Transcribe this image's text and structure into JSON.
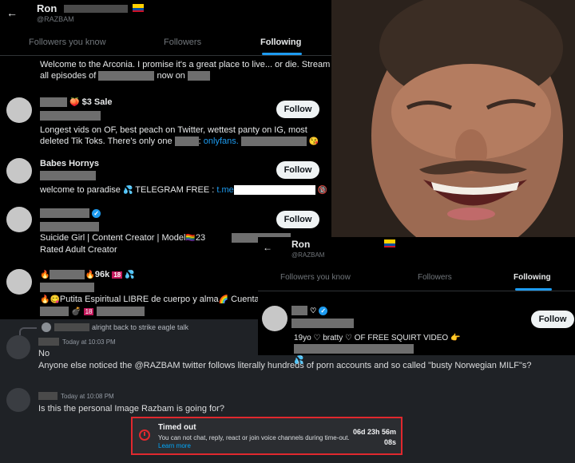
{
  "panel1": {
    "back_icon": "back-arrow-icon",
    "name": "Ron",
    "handle": "@RAZBAM",
    "tabs": [
      "Followers you know",
      "Followers",
      "Following"
    ],
    "active_tab": "Following",
    "top_bio_1": "Welcome to the Arconia. I promise it's a great place to live... or die. Stream",
    "top_bio_2a": "all episodes of",
    "top_bio_2b": "now on",
    "accounts": [
      {
        "name_suffix": "$3 Sale",
        "bio_1": "Longest vids on OF, best peach on Twitter, wettest panty on IG, most",
        "bio_2a": "deleted Tik Toks. There's only one",
        "bio_2b": "onlyfans.",
        "follow": "Follow"
      },
      {
        "name": "Babes Hornys",
        "bio_a": "welcome to paradise",
        "bio_b": "TELEGRAM FREE :",
        "bio_link": "t.me",
        "follow": "Follow"
      },
      {
        "bio_1a": "Suicide Girl | Content Creator | Model",
        "bio_1b": "23",
        "bio_2": "Rated Adult Creator",
        "follow": "Follow"
      },
      {
        "name_suffix": "96k",
        "badge": "18",
        "bio_a": "Putita Espiritual LIBRE de cuerpo y alma",
        "bio_b": "Cuenta p",
        "badge2": "18"
      }
    ]
  },
  "panel2": {
    "name": "Ron",
    "handle": "@RAZBAM",
    "tabs": [
      "Followers you know",
      "Followers",
      "Following"
    ],
    "active_tab": "Following",
    "account": {
      "bio_a": "19yo",
      "bio_b": "bratty",
      "bio_c": "OF FREE SQUIRT VIDEO",
      "follow": "Follow"
    }
  },
  "discord": {
    "reply_text": "alright back to strike eagle talk",
    "msg1_time": "Today at 10:03 PM",
    "msg1_line1": "No",
    "msg1_line2": "Anyone else noticed the @RAZBAM twitter follows literally hundreds of porn accounts and so called \"busty Norwegian MILF\"s?",
    "msg2_time": "Today at 10:08 PM",
    "msg2_line1": "Is this the personal Image Razbam is going for?",
    "timeout": {
      "title": "Timed out",
      "body": "You can not chat, reply, react or join voice channels during time-out.",
      "link": "Learn more",
      "countdown_1": "06d 23h 56m",
      "countdown_2": "08s",
      "icon": "clock-icon"
    }
  },
  "colors": {
    "accent": "#1d9bf0",
    "timeout_border": "#e0282e",
    "twitter_bg": "#000000",
    "discord_bg": "#1f2226"
  }
}
